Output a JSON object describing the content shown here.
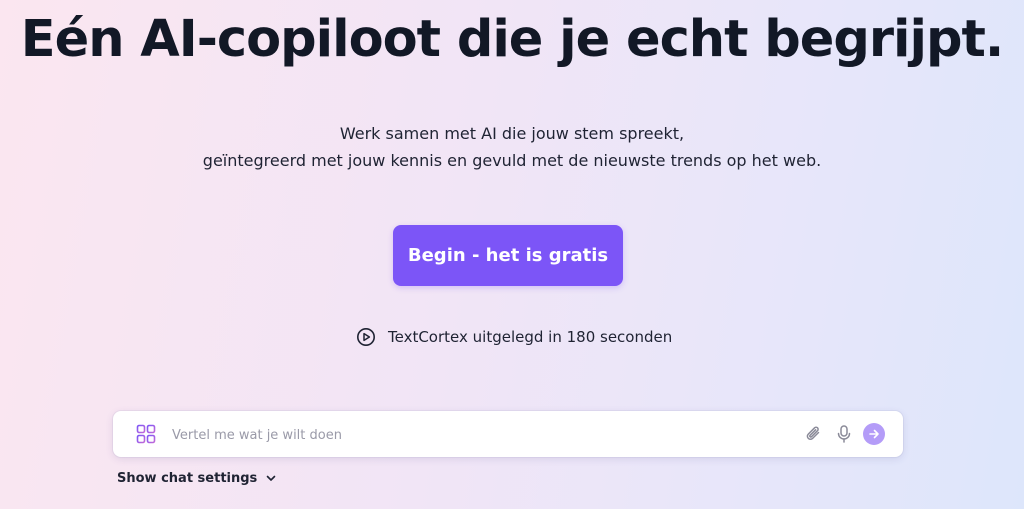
{
  "hero": {
    "headline": "Eén AI-copiloot die je echt begrijpt.",
    "subtitle_line1": "Werk samen met AI die jouw stem spreekt,",
    "subtitle_line2": "geïntegreerd met jouw kennis en gevuld met de nieuwste trends op het web.",
    "cta_label": "Begin - het is gratis",
    "video_link_label": "TextCortex uitgelegd in 180 seconden"
  },
  "chat": {
    "placeholder": "Vertel me wat je wilt doen",
    "settings_label": "Show chat settings"
  },
  "icons": {
    "video": "play-circle-icon",
    "apps": "grid-icon",
    "attach": "paperclip-icon",
    "mic": "microphone-icon",
    "send": "arrow-right-icon",
    "settings": "chevron-down-icon"
  },
  "colors": {
    "accent": "#7c55f7",
    "send_button": "#b49cf8",
    "headline": "#121826"
  }
}
